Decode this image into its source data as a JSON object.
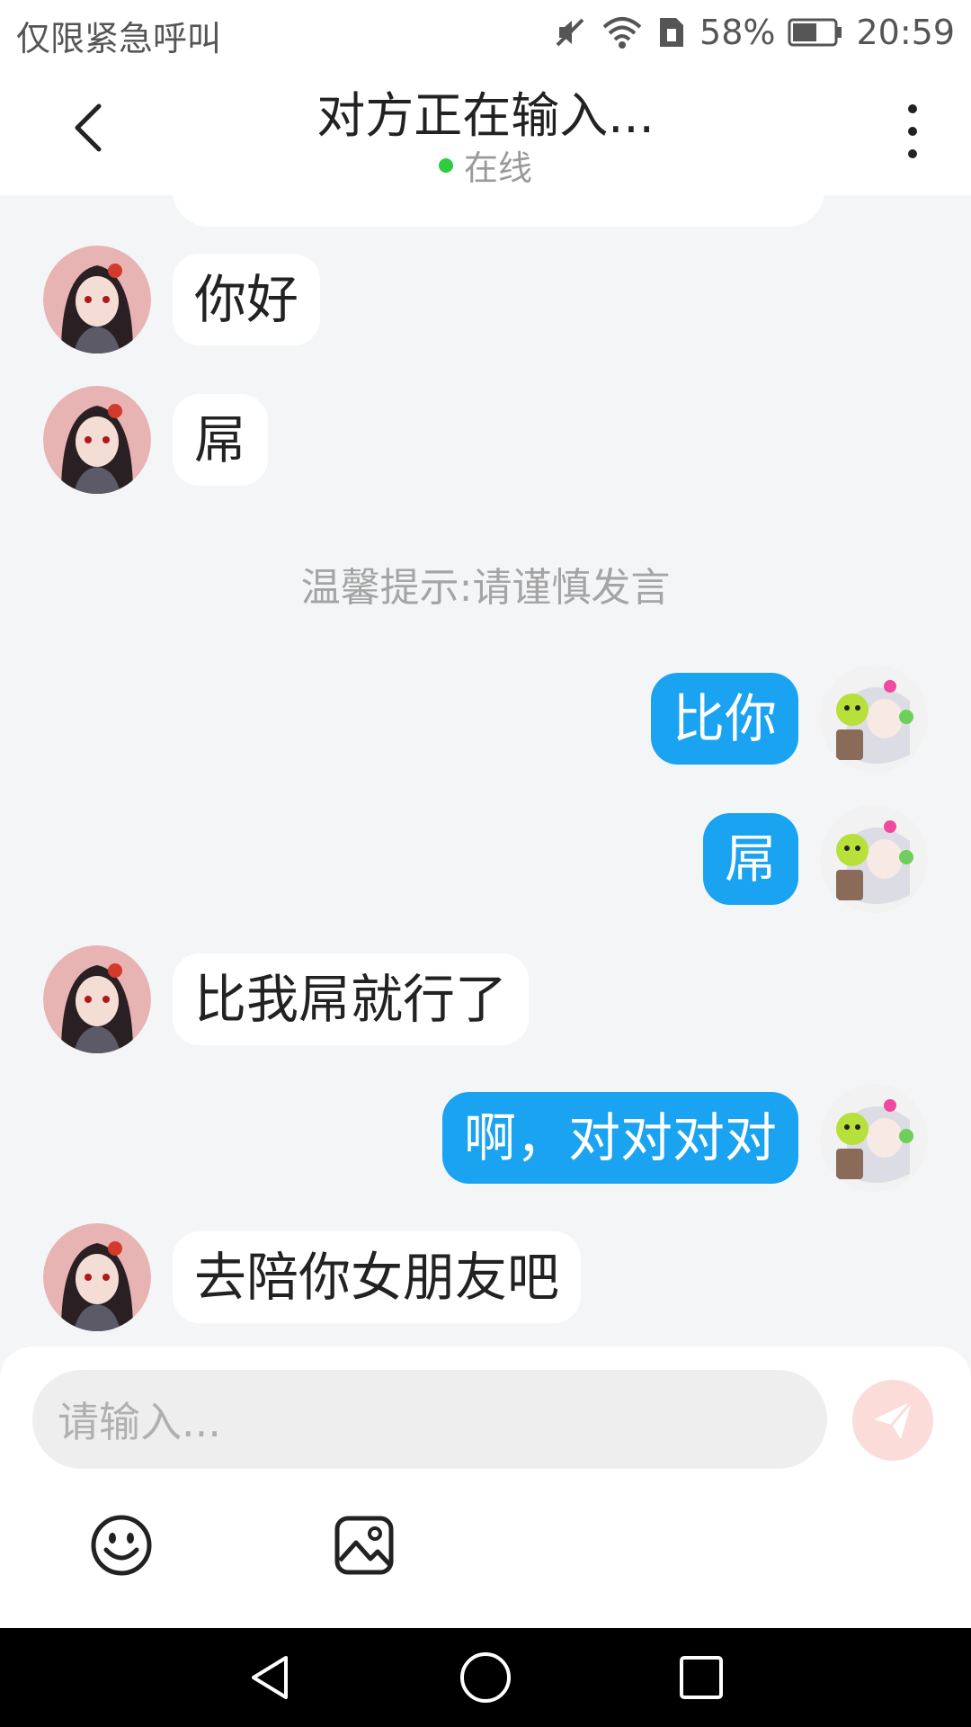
{
  "status_bar": {
    "carrier_text": "仅限紧急呼叫",
    "battery_percent": "58%",
    "time": "20:59",
    "icons": [
      "mute-icon",
      "wifi-icon",
      "sim-icon",
      "battery-icon"
    ]
  },
  "header": {
    "title": "对方正在输入...",
    "online_status": "在线",
    "online_color": "#2ecc40"
  },
  "messages": [
    {
      "side": "left",
      "text": "你好",
      "avatar": "female-avatar"
    },
    {
      "side": "left",
      "text": "屌",
      "avatar": "female-avatar"
    },
    {
      "side": "right",
      "text": "比你",
      "avatar": "user-avatar"
    },
    {
      "side": "right",
      "text": "屌",
      "avatar": "user-avatar"
    },
    {
      "side": "left",
      "text": "比我屌就行了",
      "avatar": "female-avatar"
    },
    {
      "side": "right",
      "text": "啊，对对对对",
      "avatar": "user-avatar"
    },
    {
      "side": "left",
      "text": "去陪你女朋友吧",
      "avatar": "female-avatar"
    }
  ],
  "tip": "温馨提示:请谨慎发言",
  "composer": {
    "placeholder": "请输入...",
    "send_icon": "send-icon",
    "tools": [
      "emoji-icon",
      "image-icon"
    ]
  },
  "colors": {
    "accent": "#1aa3f0",
    "background": "#f4f5f7",
    "send_disabled": "#fbdcd8"
  }
}
